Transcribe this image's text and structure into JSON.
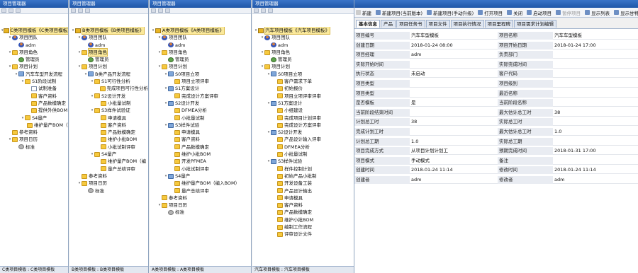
{
  "panes": [
    {
      "title": "项目管理器",
      "footer": "C类项目模板 : C类项目模板",
      "nodes": [
        {
          "d": 0,
          "t": "▾",
          "i": "root",
          "l": "C类项目模板《C类项目模板》",
          "sel": true
        },
        {
          "d": 1,
          "t": "▾",
          "i": "user",
          "l": "项目团队"
        },
        {
          "d": 2,
          "t": "",
          "i": "user",
          "l": "adm"
        },
        {
          "d": 1,
          "t": "▾",
          "i": "folder",
          "l": "项目角色"
        },
        {
          "d": 2,
          "t": "",
          "i": "role",
          "l": "管理员"
        },
        {
          "d": 1,
          "t": "▾",
          "i": "folder",
          "l": "项目计划"
        },
        {
          "d": 2,
          "t": "▾",
          "i": "net",
          "l": "汽车车型开发流程"
        },
        {
          "d": 3,
          "t": "▾",
          "i": "folder",
          "l": "S1阶段试制"
        },
        {
          "d": 4,
          "t": "",
          "i": "doc",
          "l": "试制准备"
        },
        {
          "d": 4,
          "t": "",
          "i": "folder",
          "l": "客户资料"
        },
        {
          "d": 4,
          "t": "",
          "i": "folder",
          "l": "产品数模确定"
        },
        {
          "d": 4,
          "t": "",
          "i": "folder",
          "l": "提供外供BOM"
        },
        {
          "d": 3,
          "t": "▾",
          "i": "folder",
          "l": "S4量产"
        },
        {
          "d": 4,
          "t": "",
          "i": "folder",
          "l": "维护量产BOM（…"
        },
        {
          "d": 1,
          "t": "",
          "i": "folder",
          "l": "参考资料"
        },
        {
          "d": 1,
          "t": "▾",
          "i": "folder",
          "l": "项目日历"
        },
        {
          "d": 2,
          "t": "",
          "i": "gear",
          "l": "标准"
        }
      ]
    },
    {
      "title": "项目管理器",
      "footer": "B类项目模板 : B类项目模板",
      "nodes": [
        {
          "d": 0,
          "t": "▾",
          "i": "root",
          "l": "B类项目模板《B类项目模板》",
          "sel": true
        },
        {
          "d": 1,
          "t": "▾",
          "i": "user",
          "l": "项目团队"
        },
        {
          "d": 2,
          "t": "",
          "i": "user",
          "l": "adm"
        },
        {
          "d": 1,
          "t": "▾",
          "i": "folder",
          "l": "项目角色",
          "sel": true
        },
        {
          "d": 2,
          "t": "",
          "i": "role",
          "l": "管理员"
        },
        {
          "d": 1,
          "t": "▾",
          "i": "folder",
          "l": "项目计划"
        },
        {
          "d": 2,
          "t": "▾",
          "i": "net",
          "l": "B类产品开发流程"
        },
        {
          "d": 3,
          "t": "▾",
          "i": "folder",
          "l": "S1可行性分析"
        },
        {
          "d": 4,
          "t": "",
          "i": "folder",
          "l": "完成项目可行性分析"
        },
        {
          "d": 3,
          "t": "▾",
          "i": "folder",
          "l": "S2设计开发"
        },
        {
          "d": 4,
          "t": "",
          "i": "folder",
          "l": "小批量试制"
        },
        {
          "d": 3,
          "t": "▾",
          "i": "folder",
          "l": "S3样件试验证"
        },
        {
          "d": 4,
          "t": "",
          "i": "folder",
          "l": "申请模具"
        },
        {
          "d": 4,
          "t": "",
          "i": "folder",
          "l": "客户资料"
        },
        {
          "d": 4,
          "t": "",
          "i": "folder",
          "l": "产品数模确定"
        },
        {
          "d": 4,
          "t": "",
          "i": "folder",
          "l": "维护小批BOM"
        },
        {
          "d": 4,
          "t": "",
          "i": "folder",
          "l": "小批试制评审"
        },
        {
          "d": 3,
          "t": "▾",
          "i": "folder",
          "l": "S4量产"
        },
        {
          "d": 4,
          "t": "",
          "i": "folder",
          "l": "维护量产BOM（编"
        },
        {
          "d": 4,
          "t": "",
          "i": "folder",
          "l": "量产总结评审"
        },
        {
          "d": 1,
          "t": "",
          "i": "folder",
          "l": "参考资料"
        },
        {
          "d": 1,
          "t": "▾",
          "i": "folder",
          "l": "项目日历"
        },
        {
          "d": 2,
          "t": "",
          "i": "gear",
          "l": "标准"
        }
      ]
    },
    {
      "title": "项目管理器",
      "footer": "A类项目模板 : A类项目模板",
      "nodes": [
        {
          "d": 0,
          "t": "▾",
          "i": "root",
          "l": "A类项目模板《A类项目模板》",
          "sel": true
        },
        {
          "d": 1,
          "t": "▾",
          "i": "user",
          "l": "项目团队"
        },
        {
          "d": 2,
          "t": "",
          "i": "user",
          "l": "adm"
        },
        {
          "d": 1,
          "t": "▾",
          "i": "folder",
          "l": "项目角色"
        },
        {
          "d": 2,
          "t": "",
          "i": "role",
          "l": "管理员"
        },
        {
          "d": 1,
          "t": "▾",
          "i": "folder",
          "l": "项目计划"
        },
        {
          "d": 2,
          "t": "▾",
          "i": "net",
          "l": "S0项目立项"
        },
        {
          "d": 3,
          "t": "",
          "i": "folder",
          "l": "项目立项评审"
        },
        {
          "d": 2,
          "t": "▾",
          "i": "net",
          "l": "S1方案设计"
        },
        {
          "d": 3,
          "t": "",
          "i": "folder",
          "l": "完成设计方案评审"
        },
        {
          "d": 2,
          "t": "▾",
          "i": "net",
          "l": "S2设计开发"
        },
        {
          "d": 3,
          "t": "",
          "i": "folder",
          "l": "DFMEA分析"
        },
        {
          "d": 3,
          "t": "",
          "i": "folder",
          "l": "小批量试制"
        },
        {
          "d": 2,
          "t": "▾",
          "i": "net",
          "l": "S3样件试验"
        },
        {
          "d": 3,
          "t": "",
          "i": "folder",
          "l": "申请模具"
        },
        {
          "d": 3,
          "t": "",
          "i": "folder",
          "l": "客户资料"
        },
        {
          "d": 3,
          "t": "",
          "i": "folder",
          "l": "产品数模确定"
        },
        {
          "d": 3,
          "t": "",
          "i": "folder",
          "l": "维护小批BOM"
        },
        {
          "d": 3,
          "t": "",
          "i": "folder",
          "l": "开发PFMEA"
        },
        {
          "d": 3,
          "t": "",
          "i": "folder",
          "l": "小批试制评审"
        },
        {
          "d": 2,
          "t": "▾",
          "i": "net",
          "l": "S4量产"
        },
        {
          "d": 3,
          "t": "",
          "i": "folder",
          "l": "维护量产BOM（编入BOM）"
        },
        {
          "d": 3,
          "t": "",
          "i": "folder",
          "l": "量产总结评审"
        },
        {
          "d": 1,
          "t": "",
          "i": "folder",
          "l": "参考资料"
        },
        {
          "d": 1,
          "t": "▾",
          "i": "folder",
          "l": "项目日历"
        },
        {
          "d": 2,
          "t": "",
          "i": "gear",
          "l": "标准"
        }
      ]
    },
    {
      "title": "项目管理器",
      "footer": "汽车项目模板 : 汽车项目模板",
      "nodes": [
        {
          "d": 0,
          "t": "▾",
          "i": "root",
          "l": "汽车项目模板《汽车项目模板》",
          "sel": true
        },
        {
          "d": 1,
          "t": "▾",
          "i": "user",
          "l": "项目团队"
        },
        {
          "d": 2,
          "t": "",
          "i": "user",
          "l": "adm"
        },
        {
          "d": 1,
          "t": "▾",
          "i": "folder",
          "l": "项目角色"
        },
        {
          "d": 2,
          "t": "",
          "i": "role",
          "l": "管理员"
        },
        {
          "d": 1,
          "t": "▾",
          "i": "folder",
          "l": "项目计划"
        },
        {
          "d": 2,
          "t": "▾",
          "i": "net",
          "l": "S0项目立项"
        },
        {
          "d": 3,
          "t": "",
          "i": "folder",
          "l": "客户需求下单"
        },
        {
          "d": 3,
          "t": "",
          "i": "folder",
          "l": "初始报价"
        },
        {
          "d": 3,
          "t": "",
          "i": "folder",
          "l": "项目立项评审评审"
        },
        {
          "d": 2,
          "t": "▾",
          "i": "net",
          "l": "S1方案设计"
        },
        {
          "d": 3,
          "t": "",
          "i": "folder",
          "l": "小组建设"
        },
        {
          "d": 3,
          "t": "",
          "i": "folder",
          "l": "完成项目计划评审"
        },
        {
          "d": 3,
          "t": "",
          "i": "folder",
          "l": "完成设计方案评审"
        },
        {
          "d": 2,
          "t": "▾",
          "i": "net",
          "l": "S2设计开发"
        },
        {
          "d": 3,
          "t": "",
          "i": "folder",
          "l": "产品设计输入评审"
        },
        {
          "d": 3,
          "t": "",
          "i": "folder",
          "l": "DFMEA分析"
        },
        {
          "d": 3,
          "t": "",
          "i": "folder",
          "l": "小批量试制"
        },
        {
          "d": 2,
          "t": "▾",
          "i": "net",
          "l": "S3样件试验"
        },
        {
          "d": 3,
          "t": "",
          "i": "folder",
          "l": "样件控制计划"
        },
        {
          "d": 3,
          "t": "",
          "i": "folder",
          "l": "初始产品小批制"
        },
        {
          "d": 3,
          "t": "",
          "i": "folder",
          "l": "开发设备工装"
        },
        {
          "d": 3,
          "t": "",
          "i": "folder",
          "l": "产品设计输出"
        },
        {
          "d": 3,
          "t": "",
          "i": "folder",
          "l": "申请模具"
        },
        {
          "d": 3,
          "t": "",
          "i": "folder",
          "l": "客户资料"
        },
        {
          "d": 3,
          "t": "",
          "i": "folder",
          "l": "产品数模确定"
        },
        {
          "d": 3,
          "t": "",
          "i": "folder",
          "l": "维护小批BOM"
        },
        {
          "d": 3,
          "t": "",
          "i": "folder",
          "l": "编制工作流程"
        },
        {
          "d": 3,
          "t": "",
          "i": "folder",
          "l": "评审设计文件"
        }
      ]
    }
  ],
  "toolbar": {
    "tab_label": "新建",
    "buttons": [
      {
        "label": "新建项目(当前版本)",
        "icon": "new-icon",
        "disabled": false
      },
      {
        "label": "新建项目(手动升级)",
        "icon": "new-icon",
        "disabled": false
      },
      {
        "label": "打开项目",
        "icon": "folder-icon",
        "disabled": false
      },
      {
        "label": "关闭",
        "icon": "close-icon",
        "disabled": false
      },
      {
        "label": "启动项目",
        "icon": "play-icon",
        "disabled": false
      },
      {
        "label": "暂停项目",
        "icon": "pause-icon",
        "disabled": true
      },
      {
        "label": "显示列表",
        "icon": "list-icon",
        "disabled": false
      },
      {
        "label": "显示甘特图",
        "icon": "gantt-icon",
        "disabled": false
      }
    ]
  },
  "detail_tabs": [
    "基本信息",
    "产品",
    "项目任务书",
    "项目文件",
    "项目执行情况",
    "项目里程碑",
    "项目需求计划编辑"
  ],
  "form_rows": [
    [
      "项目编号",
      "汽车车型模板",
      "项目名称",
      "汽车车型模板"
    ],
    [
      "创建日期",
      "2018-01-24 08:00",
      "项目开始日期",
      "2018-01-24 17:00"
    ],
    [
      "项目经理",
      "adm",
      "负责部门",
      ""
    ],
    [
      "实际开始时间",
      "",
      "实际完成时间",
      ""
    ],
    [
      "执行状态",
      "未启动",
      "客户代码",
      ""
    ],
    [
      "项目类型",
      "",
      "项目级别",
      ""
    ],
    [
      "项目类型",
      "",
      "最近名称",
      ""
    ],
    [
      "是否模板",
      "是",
      "当前阶段名称",
      ""
    ],
    [
      "当前阶段结束时间",
      "",
      "最大估计总工时",
      "38"
    ],
    [
      "计划总工时",
      "38",
      "实际总工时",
      ""
    ],
    [
      "完成计划工时",
      "",
      "最大估计总工时",
      "1.0"
    ],
    [
      "计划总工期",
      "1.0",
      "实际总工期",
      ""
    ],
    [
      "项目完成方式",
      "从项目计划计划工",
      "预期完成时间",
      "2018-01-31 17:00"
    ],
    [
      "项目模式",
      "手动模式",
      "备注",
      ""
    ],
    [
      "创建时间",
      "2018-01-24 11:14",
      "修改时间",
      "2018-01-24 11:14"
    ],
    [
      "创建者",
      "adm",
      "修改者",
      "adm"
    ]
  ],
  "colors": {
    "title_bar": "#2a63b8",
    "selected": "#fbe99a"
  }
}
